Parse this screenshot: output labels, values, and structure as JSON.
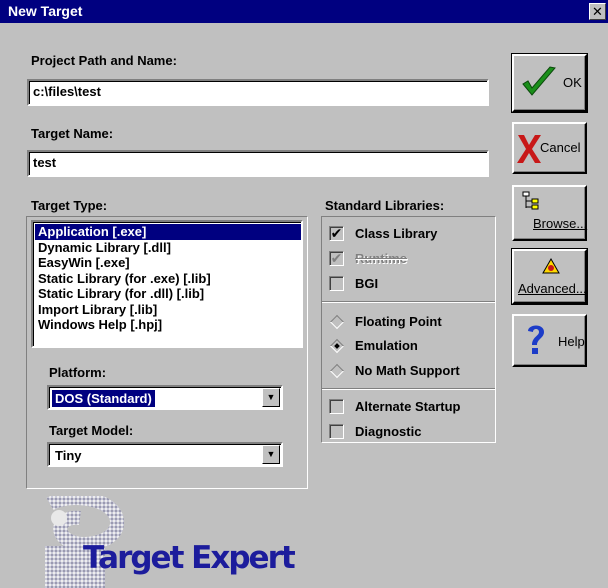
{
  "window": {
    "title": "New Target",
    "close_label": "✕"
  },
  "project": {
    "label": "Project Path and Name:",
    "value": "c:\\files\\test"
  },
  "target_name": {
    "label": "Target Name:",
    "value": "test"
  },
  "target_type": {
    "label": "Target Type:",
    "items": [
      "Application [.exe]",
      "Dynamic Library [.dll]",
      "EasyWin [.exe]",
      "Static Library (for .exe) [.lib]",
      "Static Library (for .dll) [.lib]",
      "Import Library [.lib]",
      "Windows Help [.hpj]"
    ],
    "selected": "Application [.exe]"
  },
  "platform": {
    "label": "Platform:",
    "value": "DOS (Standard)"
  },
  "target_model": {
    "label": "Target Model:",
    "value": "Tiny"
  },
  "standard_libraries": {
    "label": "Standard Libraries:",
    "checks": [
      {
        "label": "Class Library",
        "mark": "✔"
      },
      {
        "label": "Runtime",
        "mark": "✔"
      },
      {
        "label": "BGI",
        "mark": ""
      }
    ],
    "radios": [
      {
        "label": "Floating Point"
      },
      {
        "label": "Emulation"
      },
      {
        "label": "No Math Support"
      }
    ],
    "options": [
      {
        "label": "Alternate Startup",
        "mark": ""
      },
      {
        "label": "Diagnostic",
        "mark": ""
      }
    ]
  },
  "buttons": {
    "ok": "OK",
    "cancel": "Cancel",
    "browse": "Browse...",
    "advanced": "Advanced...",
    "help": "Help"
  },
  "logo": {
    "text": "Target Expert"
  },
  "colors": {
    "title_bar": "#000080",
    "selection": "#000080",
    "face": "#c0c0c0",
    "ok_check": "#1a8f1a",
    "cancel_x": "#c81818",
    "help_q": "#1c3cc8"
  }
}
